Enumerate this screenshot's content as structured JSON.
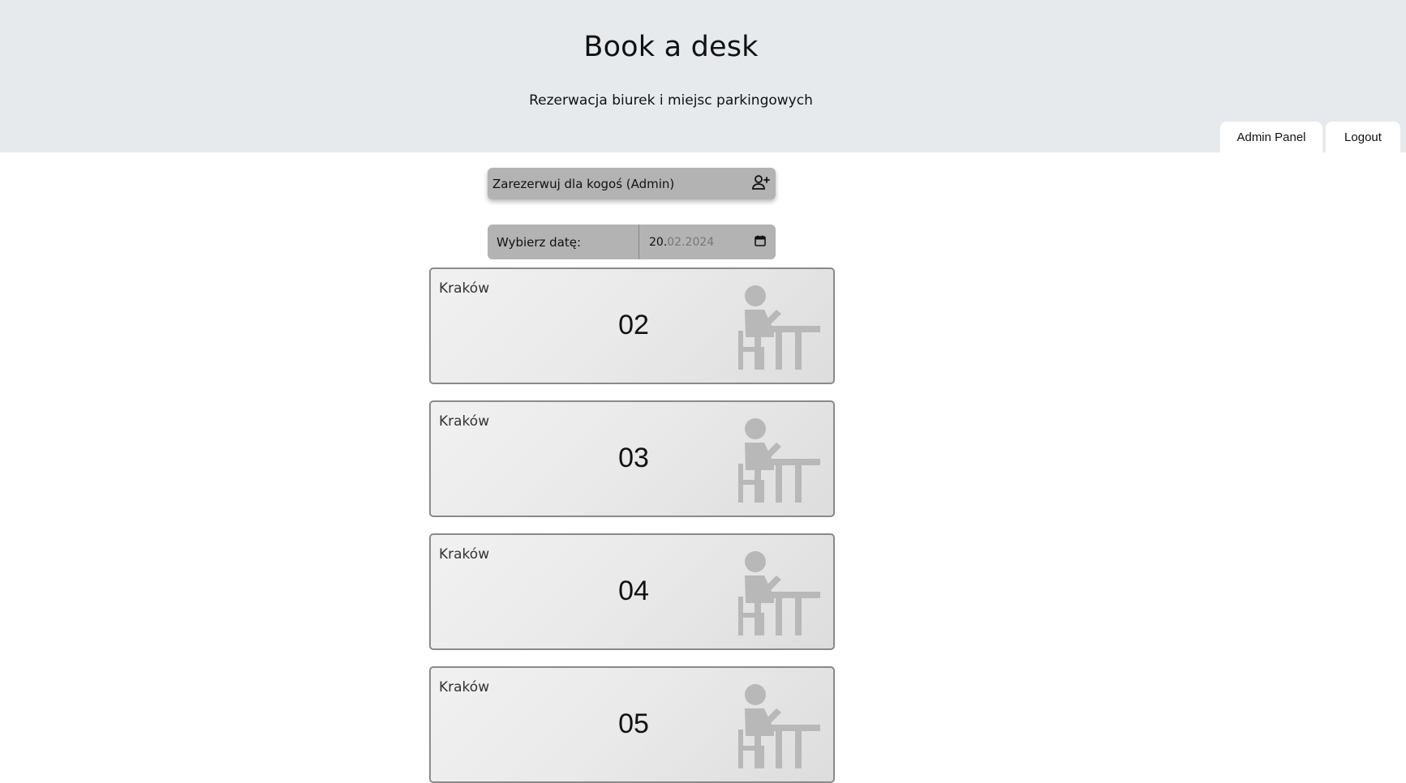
{
  "header": {
    "title": "Book a desk",
    "subtitle": "Rezerwacja biurek i miejsc parkingowych",
    "tabs": [
      {
        "label": "Admin Panel"
      },
      {
        "label": "Logout"
      }
    ]
  },
  "admin_book": {
    "label": "Zarezerwuj dla kogoś (Admin)",
    "icon": "person-add-icon"
  },
  "date_picker": {
    "label": "Wybierz datę:",
    "value_day": "20.",
    "value_rest": "02.2024",
    "icon": "calendar-icon"
  },
  "desks": [
    {
      "location": "Kraków",
      "number": "02",
      "icon": "person-at-desk-icon"
    },
    {
      "location": "Kraków",
      "number": "03",
      "icon": "person-at-desk-icon"
    },
    {
      "location": "Kraków",
      "number": "04",
      "icon": "person-at-desk-icon"
    },
    {
      "location": "Kraków",
      "number": "05",
      "icon": "person-at-desk-icon"
    }
  ],
  "colors": {
    "header_bg": "#e7eaed",
    "control_bg": "#b3b3b3",
    "icon_gray": "#b7b7b7"
  }
}
